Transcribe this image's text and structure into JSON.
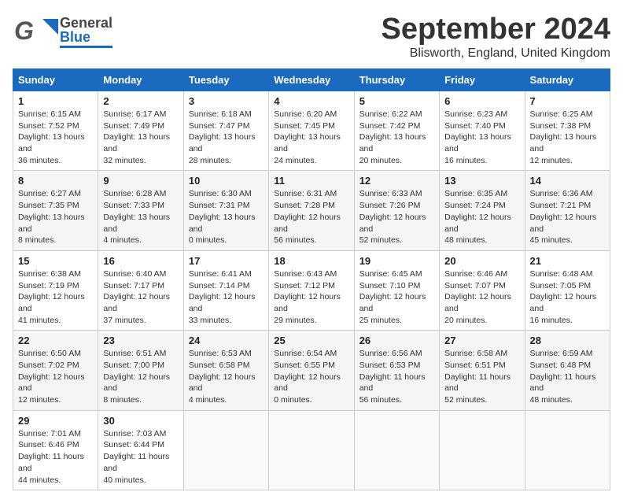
{
  "header": {
    "logo_top": "General",
    "logo_bottom": "Blue",
    "month": "September 2024",
    "location": "Blisworth, England, United Kingdom"
  },
  "days_of_week": [
    "Sunday",
    "Monday",
    "Tuesday",
    "Wednesday",
    "Thursday",
    "Friday",
    "Saturday"
  ],
  "weeks": [
    [
      {
        "day": "1",
        "sunrise": "6:15 AM",
        "sunset": "7:52 PM",
        "daylight": "13 hours and 36 minutes."
      },
      {
        "day": "2",
        "sunrise": "6:17 AM",
        "sunset": "7:49 PM",
        "daylight": "13 hours and 32 minutes."
      },
      {
        "day": "3",
        "sunrise": "6:18 AM",
        "sunset": "7:47 PM",
        "daylight": "13 hours and 28 minutes."
      },
      {
        "day": "4",
        "sunrise": "6:20 AM",
        "sunset": "7:45 PM",
        "daylight": "13 hours and 24 minutes."
      },
      {
        "day": "5",
        "sunrise": "6:22 AM",
        "sunset": "7:42 PM",
        "daylight": "13 hours and 20 minutes."
      },
      {
        "day": "6",
        "sunrise": "6:23 AM",
        "sunset": "7:40 PM",
        "daylight": "13 hours and 16 minutes."
      },
      {
        "day": "7",
        "sunrise": "6:25 AM",
        "sunset": "7:38 PM",
        "daylight": "13 hours and 12 minutes."
      }
    ],
    [
      {
        "day": "8",
        "sunrise": "6:27 AM",
        "sunset": "7:35 PM",
        "daylight": "13 hours and 8 minutes."
      },
      {
        "day": "9",
        "sunrise": "6:28 AM",
        "sunset": "7:33 PM",
        "daylight": "13 hours and 4 minutes."
      },
      {
        "day": "10",
        "sunrise": "6:30 AM",
        "sunset": "7:31 PM",
        "daylight": "13 hours and 0 minutes."
      },
      {
        "day": "11",
        "sunrise": "6:31 AM",
        "sunset": "7:28 PM",
        "daylight": "12 hours and 56 minutes."
      },
      {
        "day": "12",
        "sunrise": "6:33 AM",
        "sunset": "7:26 PM",
        "daylight": "12 hours and 52 minutes."
      },
      {
        "day": "13",
        "sunrise": "6:35 AM",
        "sunset": "7:24 PM",
        "daylight": "12 hours and 48 minutes."
      },
      {
        "day": "14",
        "sunrise": "6:36 AM",
        "sunset": "7:21 PM",
        "daylight": "12 hours and 45 minutes."
      }
    ],
    [
      {
        "day": "15",
        "sunrise": "6:38 AM",
        "sunset": "7:19 PM",
        "daylight": "12 hours and 41 minutes."
      },
      {
        "day": "16",
        "sunrise": "6:40 AM",
        "sunset": "7:17 PM",
        "daylight": "12 hours and 37 minutes."
      },
      {
        "day": "17",
        "sunrise": "6:41 AM",
        "sunset": "7:14 PM",
        "daylight": "12 hours and 33 minutes."
      },
      {
        "day": "18",
        "sunrise": "6:43 AM",
        "sunset": "7:12 PM",
        "daylight": "12 hours and 29 minutes."
      },
      {
        "day": "19",
        "sunrise": "6:45 AM",
        "sunset": "7:10 PM",
        "daylight": "12 hours and 25 minutes."
      },
      {
        "day": "20",
        "sunrise": "6:46 AM",
        "sunset": "7:07 PM",
        "daylight": "12 hours and 20 minutes."
      },
      {
        "day": "21",
        "sunrise": "6:48 AM",
        "sunset": "7:05 PM",
        "daylight": "12 hours and 16 minutes."
      }
    ],
    [
      {
        "day": "22",
        "sunrise": "6:50 AM",
        "sunset": "7:02 PM",
        "daylight": "12 hours and 12 minutes."
      },
      {
        "day": "23",
        "sunrise": "6:51 AM",
        "sunset": "7:00 PM",
        "daylight": "12 hours and 8 minutes."
      },
      {
        "day": "24",
        "sunrise": "6:53 AM",
        "sunset": "6:58 PM",
        "daylight": "12 hours and 4 minutes."
      },
      {
        "day": "25",
        "sunrise": "6:54 AM",
        "sunset": "6:55 PM",
        "daylight": "12 hours and 0 minutes."
      },
      {
        "day": "26",
        "sunrise": "6:56 AM",
        "sunset": "6:53 PM",
        "daylight": "11 hours and 56 minutes."
      },
      {
        "day": "27",
        "sunrise": "6:58 AM",
        "sunset": "6:51 PM",
        "daylight": "11 hours and 52 minutes."
      },
      {
        "day": "28",
        "sunrise": "6:59 AM",
        "sunset": "6:48 PM",
        "daylight": "11 hours and 48 minutes."
      }
    ],
    [
      {
        "day": "29",
        "sunrise": "7:01 AM",
        "sunset": "6:46 PM",
        "daylight": "11 hours and 44 minutes."
      },
      {
        "day": "30",
        "sunrise": "7:03 AM",
        "sunset": "6:44 PM",
        "daylight": "11 hours and 40 minutes."
      },
      null,
      null,
      null,
      null,
      null
    ]
  ],
  "labels": {
    "sunrise": "Sunrise:",
    "sunset": "Sunset:",
    "daylight": "Daylight:"
  }
}
